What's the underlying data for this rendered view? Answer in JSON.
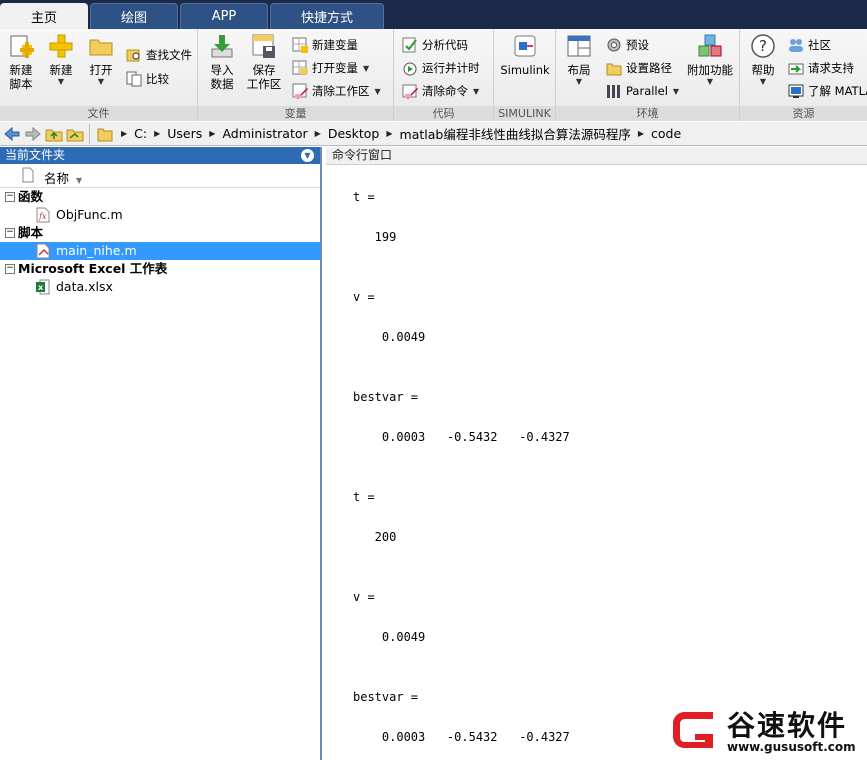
{
  "tabs": [
    "主页",
    "绘图",
    "APP",
    "快捷方式"
  ],
  "ribbon": {
    "file": {
      "label": "文件",
      "new_script": "新建\n脚本",
      "new": "新建",
      "open": "打开",
      "find_files": "查找文件",
      "compare": "比较"
    },
    "variable": {
      "label": "变量",
      "import": "导入\n数据",
      "save": "保存\n工作区",
      "new_var": "新建变量",
      "open_var": "打开变量",
      "clear_ws": "清除工作区"
    },
    "code": {
      "label": "代码",
      "analyze": "分析代码",
      "run_time": "运行并计时",
      "clear_cmd": "清除命令"
    },
    "simulink": {
      "label": "SIMULINK",
      "btn": "Simulink"
    },
    "env": {
      "label": "环境",
      "layout": "布局",
      "prefs": "预设",
      "set_path": "设置路径",
      "parallel": "Parallel",
      "addons": "附加功能"
    },
    "resources": {
      "label": "资源",
      "help": "帮助",
      "community": "社区",
      "support": "请求支持",
      "learn": "了解 MATLAB"
    }
  },
  "address": {
    "crumbs": [
      "C:",
      "Users",
      "Administrator",
      "Desktop",
      "matlab编程非线性曲线拟合算法源码程序",
      "code"
    ]
  },
  "current_folder": {
    "title": "当前文件夹",
    "column": "名称",
    "groups": [
      {
        "name": "函数",
        "files": [
          "ObjFunc.m"
        ]
      },
      {
        "name": "脚本",
        "files": [
          "main_nihe.m"
        ]
      },
      {
        "name": "Microsoft Excel 工作表",
        "files": [
          "data.xlsx"
        ]
      }
    ]
  },
  "command_window": {
    "title": "命令行窗口",
    "lines": [
      "t =",
      "",
      "   199",
      "",
      "",
      "v =",
      "",
      "    0.0049",
      "",
      "",
      "bestvar =",
      "",
      "    0.0003   -0.5432   -0.4327",
      "",
      "",
      "t =",
      "",
      "   200",
      "",
      "",
      "v =",
      "",
      "    0.0049",
      "",
      "",
      "bestvar =",
      "",
      "    0.0003   -0.5432   -0.4327"
    ]
  },
  "watermark": {
    "text": "谷速软件",
    "url": "www.gususoft.com"
  }
}
